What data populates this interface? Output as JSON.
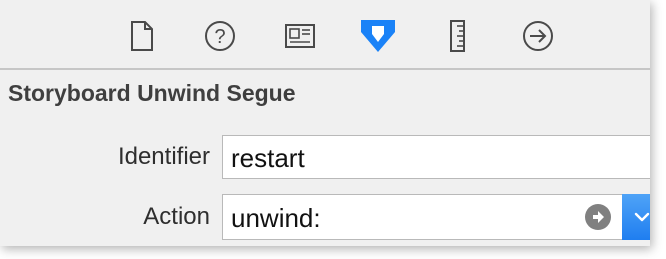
{
  "toolbar": {
    "icons": [
      {
        "name": "file-inspector-icon"
      },
      {
        "name": "quick-help-icon"
      },
      {
        "name": "identity-inspector-icon"
      },
      {
        "name": "attributes-inspector-icon",
        "selected": true
      },
      {
        "name": "size-inspector-icon"
      },
      {
        "name": "connections-inspector-icon"
      }
    ],
    "selected_color": "#1a82f7",
    "icon_color": "#4a4a4a"
  },
  "section": {
    "title": "Storyboard Unwind Segue"
  },
  "fields": {
    "identifier_label": "Identifier",
    "identifier_value": "restart",
    "action_label": "Action",
    "action_value": "unwind:"
  },
  "colors": {
    "accent": "#1f7ef0",
    "panel_bg": "#f0f0f0"
  }
}
